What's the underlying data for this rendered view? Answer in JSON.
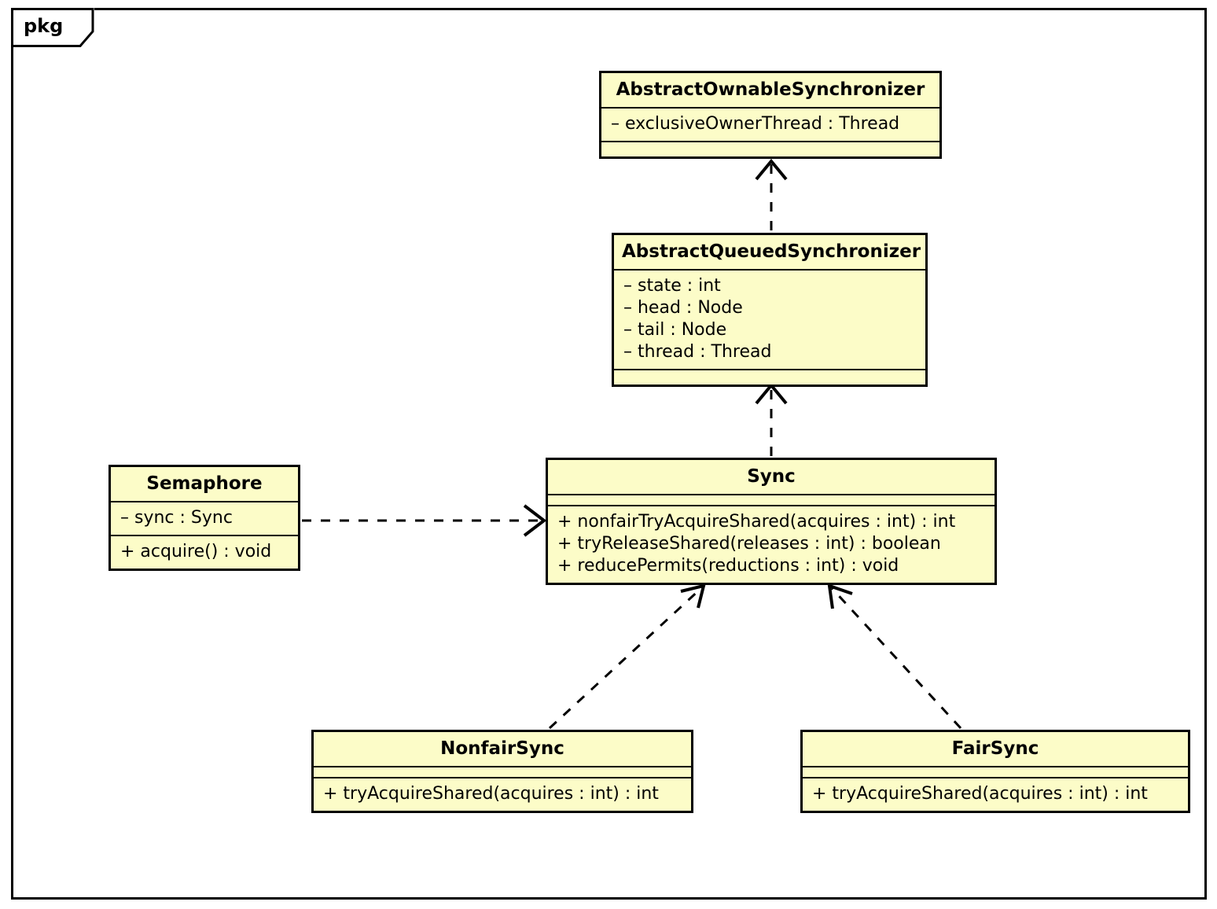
{
  "diagram": {
    "type": "uml-class-diagram",
    "package_label": "pkg",
    "colors": {
      "class_fill": "#fcfcc8",
      "border": "#000000",
      "text": "#000000",
      "background": "#ffffff"
    }
  },
  "classes": {
    "abstract_ownable_synchronizer": {
      "name": "AbstractOwnableSynchronizer",
      "attributes": [
        "– exclusiveOwnerThread : Thread"
      ],
      "methods": []
    },
    "abstract_queued_synchronizer": {
      "name": "AbstractQueuedSynchronizer",
      "attributes": [
        "– state : int",
        "– head : Node",
        "– tail : Node",
        "– thread : Thread"
      ],
      "methods": []
    },
    "sync": {
      "name": "Sync",
      "attributes": [],
      "methods": [
        "+ nonfairTryAcquireShared(acquires : int) : int",
        "+ tryReleaseShared(releases : int) : boolean",
        "+ reducePermits(reductions : int) : void"
      ]
    },
    "semaphore": {
      "name": "Semaphore",
      "attributes": [
        "– sync : Sync"
      ],
      "methods": [
        "+ acquire() : void"
      ]
    },
    "nonfair_sync": {
      "name": "NonfairSync",
      "attributes": [],
      "methods": [
        "+ tryAcquireShared(acquires : int) : int"
      ]
    },
    "fair_sync": {
      "name": "FairSync",
      "attributes": [],
      "methods": [
        "+ tryAcquireShared(acquires : int) : int"
      ]
    }
  },
  "relationships": [
    {
      "id": "aqs-to-aos",
      "kind": "generalization-dashed",
      "from": "AbstractQueuedSynchronizer",
      "to": "AbstractOwnableSynchronizer",
      "style": "dashed",
      "arrowhead": "open"
    },
    {
      "id": "sync-to-aqs",
      "kind": "generalization-dashed",
      "from": "Sync",
      "to": "AbstractQueuedSynchronizer",
      "style": "dashed",
      "arrowhead": "open"
    },
    {
      "id": "semaphore-to-sync",
      "kind": "dependency",
      "from": "Semaphore",
      "to": "Sync",
      "style": "dashed",
      "arrowhead": "open"
    },
    {
      "id": "nonfairsync-to-sync",
      "kind": "generalization-dashed",
      "from": "NonfairSync",
      "to": "Sync",
      "style": "dashed",
      "arrowhead": "open"
    },
    {
      "id": "fairsync-to-sync",
      "kind": "generalization-dashed",
      "from": "FairSync",
      "to": "Sync",
      "style": "dashed",
      "arrowhead": "open"
    }
  ]
}
